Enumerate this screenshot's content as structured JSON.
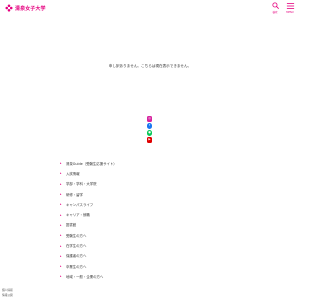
{
  "header": {
    "logo_text": "清泉女子大学",
    "search_label": "検索",
    "menu_label": "MENU"
  },
  "colors": {
    "accent": "#e5007f",
    "text": "#333333",
    "instagram": "#d6249f",
    "facebook": "#1877f2",
    "line": "#06c755",
    "youtube": "#e00000"
  },
  "message": "申し訳ありません。こちらは現在表示できません。",
  "social": [
    {
      "name": "instagram-icon"
    },
    {
      "name": "facebook-icon"
    },
    {
      "name": "line-icon"
    },
    {
      "name": "youtube-icon"
    }
  ],
  "links": [
    "清泉Guide（受験生応援サイト）",
    "入試情報",
    "学部・学科・大学院",
    "研修・留学",
    "キャンパスライフ",
    "キャリア・就職",
    "図書館",
    "受験生の方へ",
    "在学生の方へ",
    "保護者の方へ",
    "卒業生の方へ",
    "地域・一般・企業の方へ"
  ],
  "footer": {
    "line1": "個人情報",
    "line2": "情報公開"
  }
}
